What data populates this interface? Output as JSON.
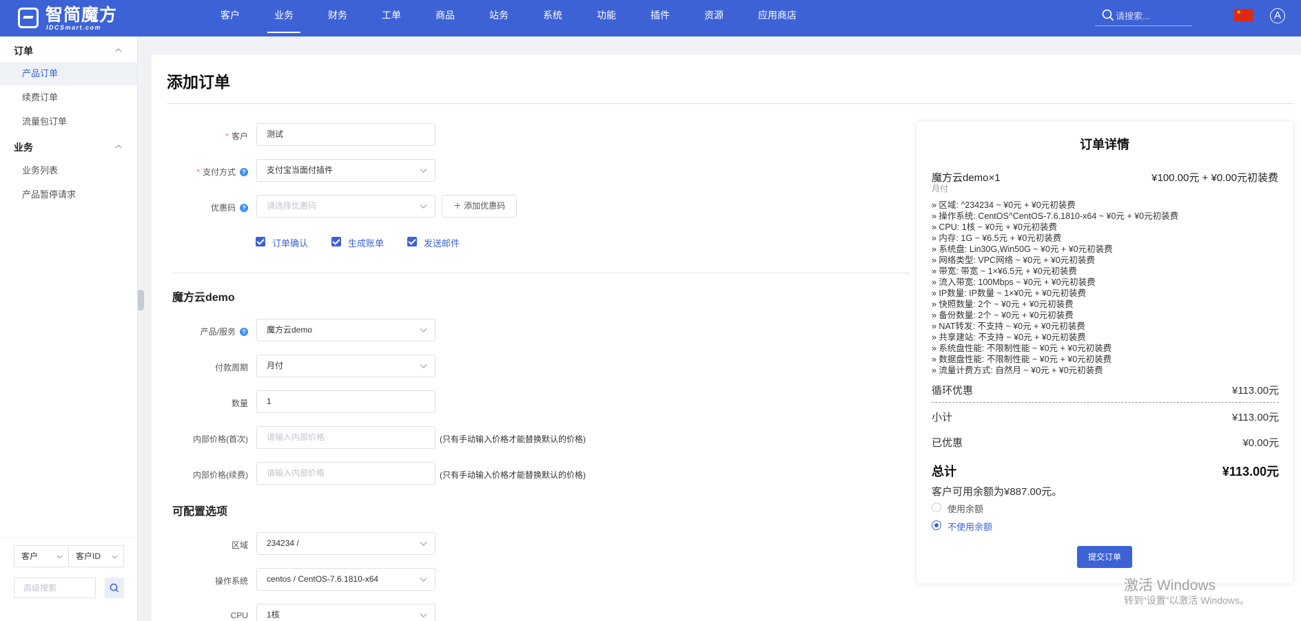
{
  "brand": {
    "name_cn": "智简魔方",
    "name_en": "IDCSmart.com"
  },
  "nav": [
    "客户",
    "业务",
    "财务",
    "工单",
    "商品",
    "站务",
    "系统",
    "功能",
    "插件",
    "资源",
    "应用商店"
  ],
  "search": {
    "placeholder": "请搜索..."
  },
  "avatar": "A",
  "sidebar": {
    "groups": [
      {
        "title": "订单",
        "items": [
          "产品订单",
          "续费订单",
          "流量包订单"
        ]
      },
      {
        "title": "业务",
        "items": [
          "业务列表",
          "产品暂停请求"
        ]
      }
    ],
    "filter": {
      "select1": "客户",
      "select2": "客户ID",
      "adv_placeholder": "高级搜索"
    }
  },
  "page": {
    "title": "添加订单"
  },
  "form": {
    "customer": {
      "label": "客户",
      "value": "测试"
    },
    "payment": {
      "label": "支付方式",
      "value": "支付宝当面付插件"
    },
    "coupon": {
      "label": "优惠码",
      "placeholder": "请选择优惠码",
      "button": "添加优惠码"
    },
    "checks": [
      "订单确认",
      "生成账单",
      "发送邮件"
    ]
  },
  "product_section": {
    "title": "魔方云demo",
    "product": {
      "label": "产品/服务",
      "value": "魔方云demo"
    },
    "cycle": {
      "label": "付款周期",
      "value": "月付"
    },
    "qty": {
      "label": "数量",
      "value": "1"
    },
    "internal_first": {
      "label": "内部价格(首次)",
      "placeholder": "请输入内部价格",
      "hint": "(只有手动输入价格才能替换默认的价格)"
    },
    "internal_renew": {
      "label": "内部价格(续费)",
      "placeholder": "请输入内部价格",
      "hint": "(只有手动输入价格才能替换默认的价格)"
    }
  },
  "config_section": {
    "title": "可配置选项",
    "region": {
      "label": "区域",
      "value": "234234 /"
    },
    "os": {
      "label": "操作系统",
      "value": "centos / CentOS-7.6.1810-x64"
    },
    "cpu": {
      "label": "CPU",
      "value": "1核"
    }
  },
  "details": {
    "title": "订单详情",
    "product": "魔方云demo×1",
    "cycle": "月付",
    "price": "¥100.00元 + ¥0.00元初装费",
    "options": [
      "» 区域: ^234234 ~ ¥0元 + ¥0元初装费",
      "» 操作系统: CentOS^CentOS-7.6.1810-x64 ~ ¥0元 + ¥0元初装费",
      "» CPU: 1核 ~ ¥0元 + ¥0元初装费",
      "» 内存: 1G ~ ¥6.5元 + ¥0元初装费",
      "» 系统盘: Lin30G,Win50G ~ ¥0元 + ¥0元初装费",
      "» 网络类型: VPC网络 ~ ¥0元 + ¥0元初装费",
      "» 带宽: 带宽 ~ 1×¥6.5元 + ¥0元初装费",
      "» 流入带宽: 100Mbps ~ ¥0元 + ¥0元初装费",
      "» IP数量: IP数量 ~ 1×¥0元 + ¥0元初装费",
      "» 快照数量: 2个 ~ ¥0元 + ¥0元初装费",
      "» 备份数量: 2个 ~ ¥0元 + ¥0元初装费",
      "» NAT转发: 不支持 ~ ¥0元 + ¥0元初装费",
      "» 共享建站: 不支持 ~ ¥0元 + ¥0元初装费",
      "» 系统盘性能: 不限制性能 ~ ¥0元 + ¥0元初装费",
      "» 数据盘性能: 不限制性能 ~ ¥0元 + ¥0元初装费",
      "» 流量计费方式: 自然月 ~ ¥0元 + ¥0元初装费"
    ],
    "recurring": {
      "label": "循环优惠",
      "value": "¥113.00元"
    },
    "subtotal": {
      "label": "小计",
      "value": "¥113.00元"
    },
    "discounted": {
      "label": "已优惠",
      "value": "¥0.00元"
    },
    "total": {
      "label": "总计",
      "value": "¥113.00元"
    },
    "balance": "客户可用余额为¥887.00元。",
    "use_balance": "使用余额",
    "no_balance": "不使用余额",
    "submit": "提交订单"
  },
  "watermark": {
    "line1": "激活 Windows",
    "line2": "转到“设置”以激活 Windows。"
  },
  "colors": {
    "primary": "#3c62d6",
    "danger": "#f56c6c",
    "help": "#3c8ff5"
  }
}
